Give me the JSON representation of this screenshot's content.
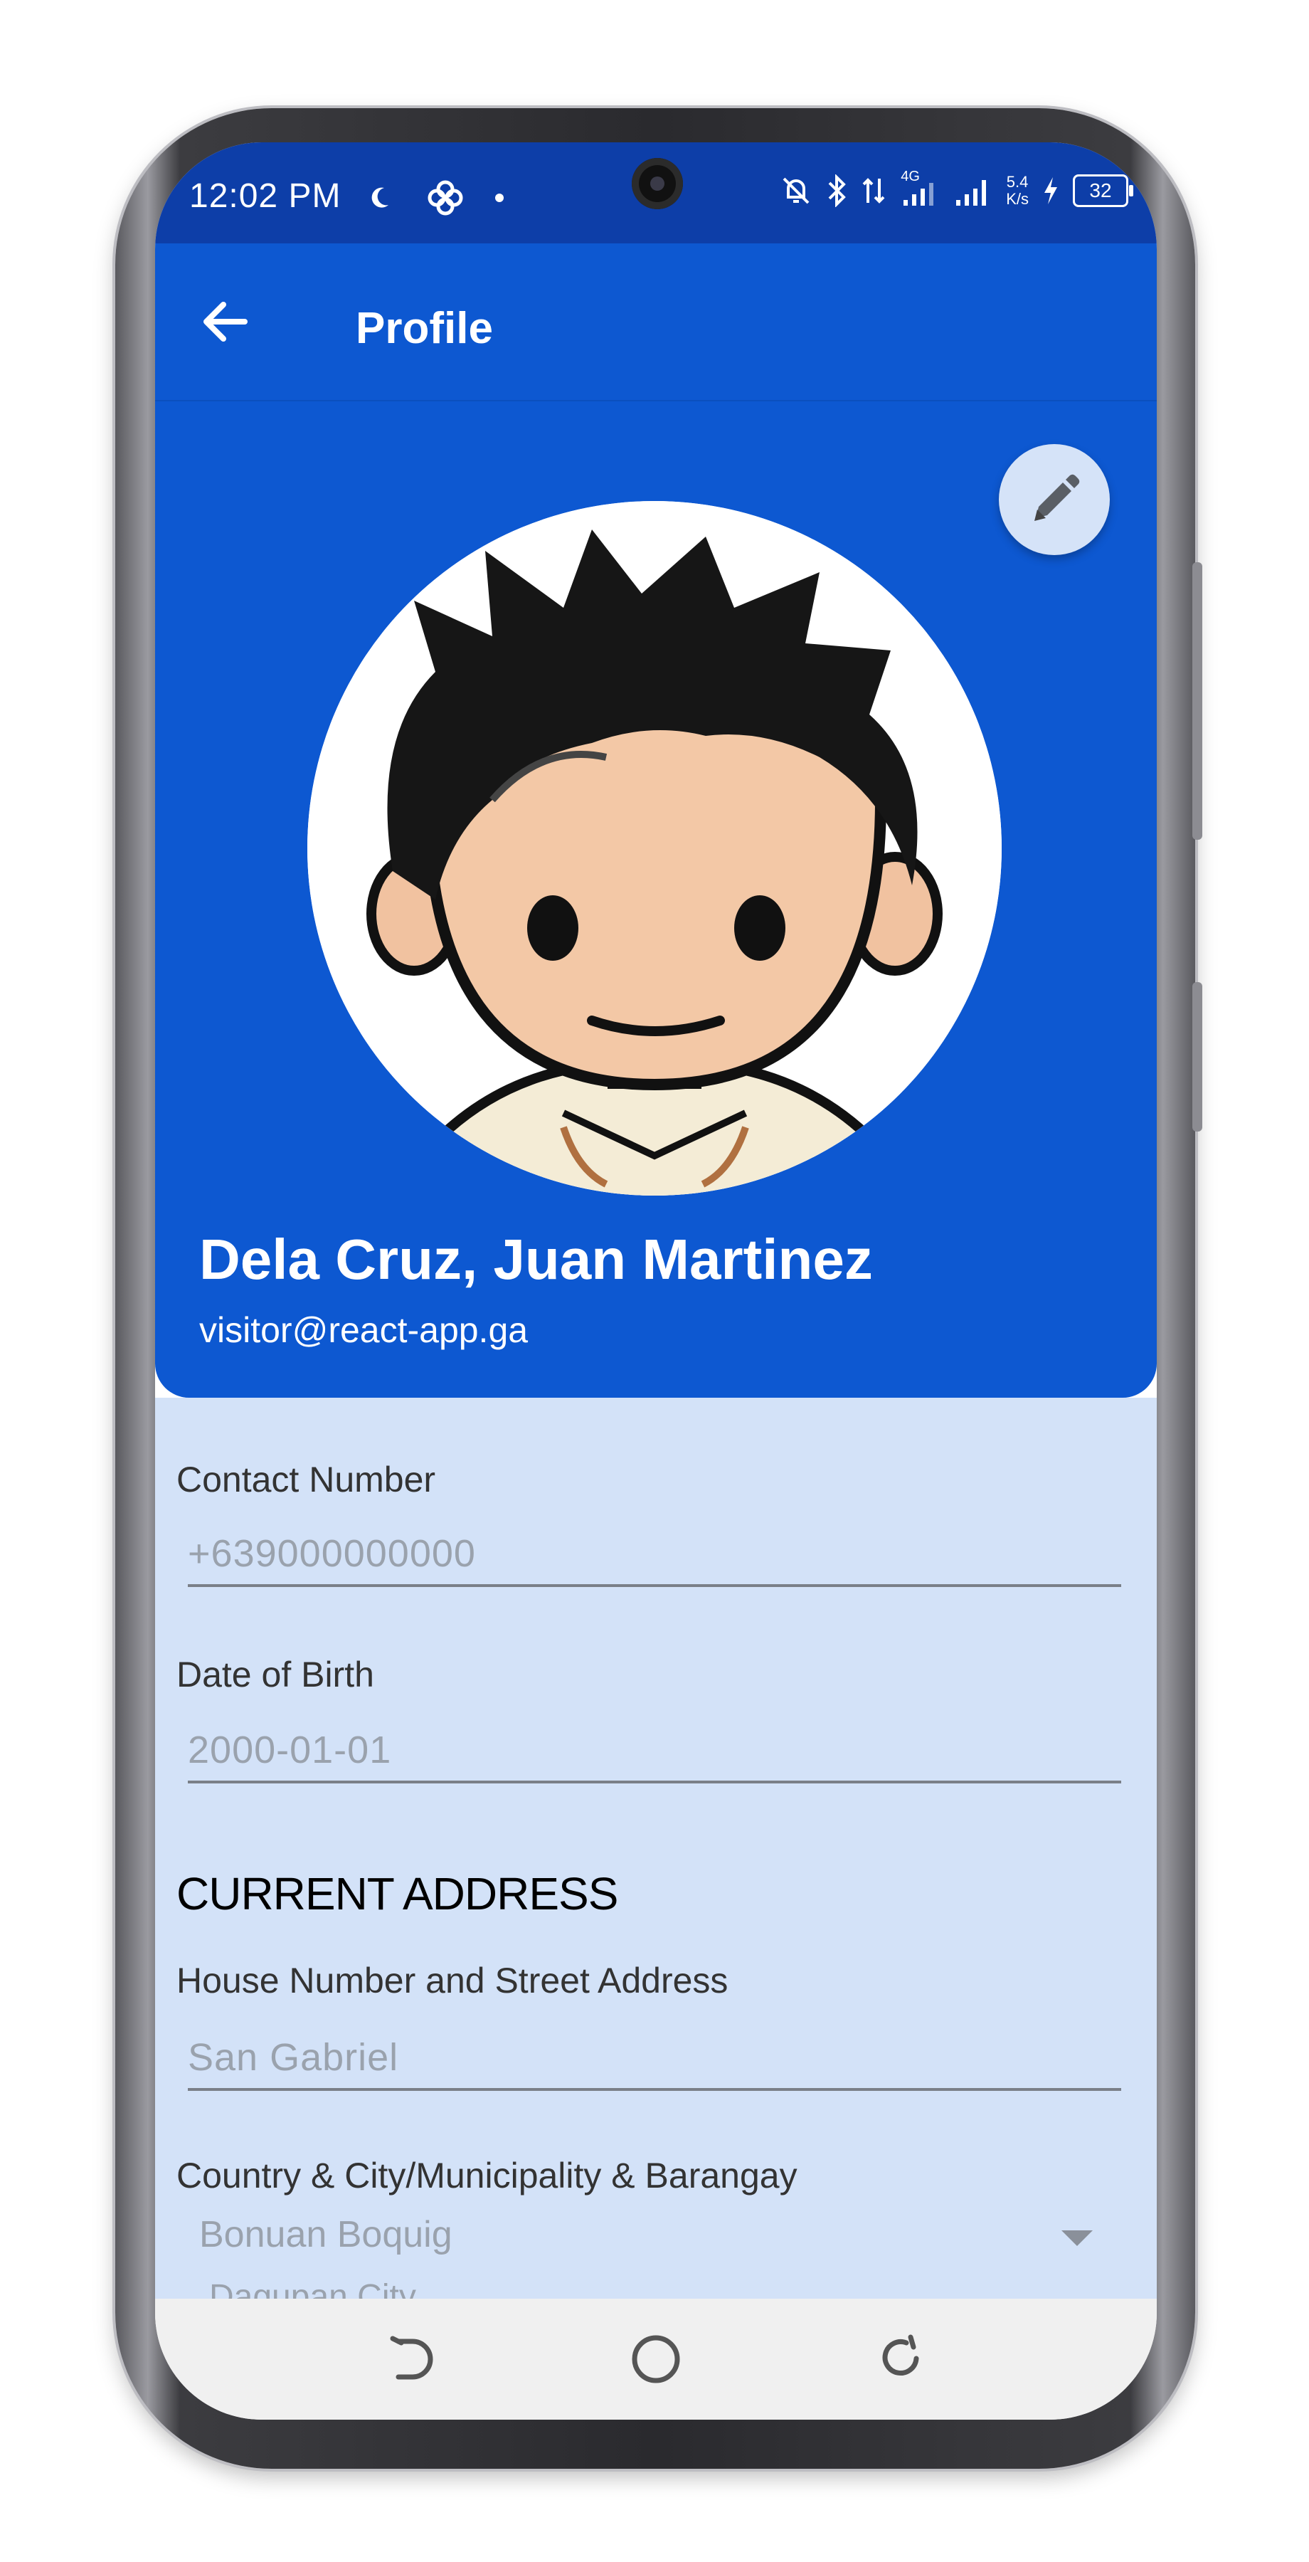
{
  "status_bar": {
    "time": "12:02 PM",
    "network_speed_value": "5.4",
    "network_speed_unit": "K/s",
    "network_type": "4G",
    "battery_level": "32"
  },
  "header": {
    "title": "Profile"
  },
  "profile": {
    "name": "Dela Cruz, Juan Martinez",
    "email": "visitor@react-app.ga"
  },
  "form": {
    "contact_label": "Contact Number",
    "contact_placeholder": "+639000000000",
    "dob_label": "Date of Birth",
    "dob_placeholder": "2000-01-01",
    "address_section": "CURRENT ADDRESS",
    "street_label": "House Number and Street Address",
    "street_placeholder": "San Gabriel",
    "location_label": "Country & City/Municipality & Barangay",
    "location_value_line1": "Bonuan Boquig",
    "location_value_line2": "Dagupan City"
  },
  "colors": {
    "primary": "#0d58d1",
    "status_bar": "#0d3ea8",
    "form_background": "#d3e2f8",
    "fab_background": "#d5e3f8"
  },
  "icons": {
    "back": "arrow-left-icon",
    "edit": "pencil-icon",
    "nav_back": "back-nav-icon",
    "nav_home": "home-circle-icon",
    "nav_recents": "recents-icon"
  }
}
